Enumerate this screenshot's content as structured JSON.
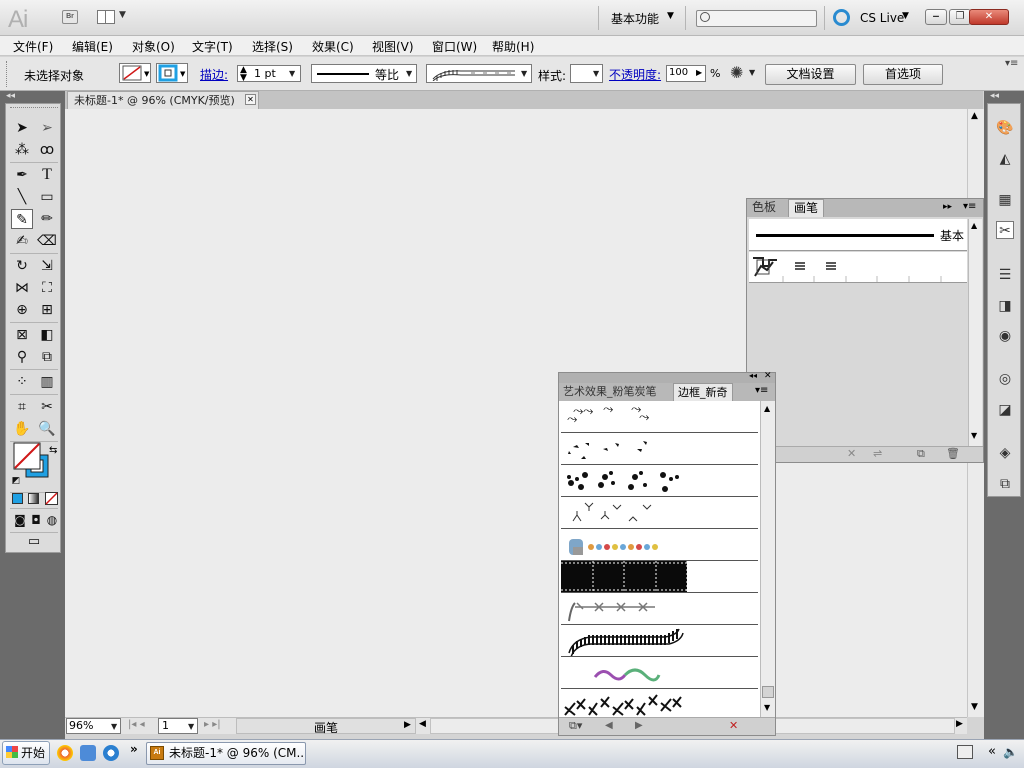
{
  "app": {
    "logo": "Ai",
    "bridge_label": "Br",
    "workspace": "基本功能",
    "search_placeholder": "",
    "cs_live": "CS Live"
  },
  "menu": [
    "文件(F)",
    "编辑(E)",
    "对象(O)",
    "文字(T)",
    "选择(S)",
    "效果(C)",
    "视图(V)",
    "窗口(W)",
    "帮助(H)"
  ],
  "control": {
    "selection_status": "未选择对象",
    "stroke_label": "描边:",
    "stroke_weight": "1 pt",
    "profile_label": "等比",
    "style_label": "样式:",
    "opacity_label": "不透明度:",
    "opacity_value": "100",
    "opacity_unit": "%",
    "doc_setup": "文档设置",
    "preferences": "首选项"
  },
  "document": {
    "tab_title": "未标题-1* @ 96% (CMYK/预览)",
    "zoom": "96%",
    "artboard": "1",
    "status": "画笔"
  },
  "brush_panel": {
    "tabs": [
      "色板",
      "画笔"
    ],
    "active_tab": "画笔",
    "basic_label": "基本"
  },
  "library_panel": {
    "tabs": [
      "艺术效果_粉笔炭笔",
      "边框_新奇"
    ],
    "active_tab": "边框_新奇",
    "rows": [
      "bird-tracks",
      "small-tracks",
      "paw-prints",
      "chicken-tracks",
      "flower-chain",
      "film-strip",
      "barbed-wire",
      "railroad-track",
      "wave-ribbon",
      "stitch-cross"
    ]
  },
  "taskbar": {
    "start": "开始",
    "task_item": "未标题-1* @ 96% (CM..."
  },
  "colors": {
    "accent_blue": "#1fa0e3",
    "none_red": "#d01818"
  }
}
